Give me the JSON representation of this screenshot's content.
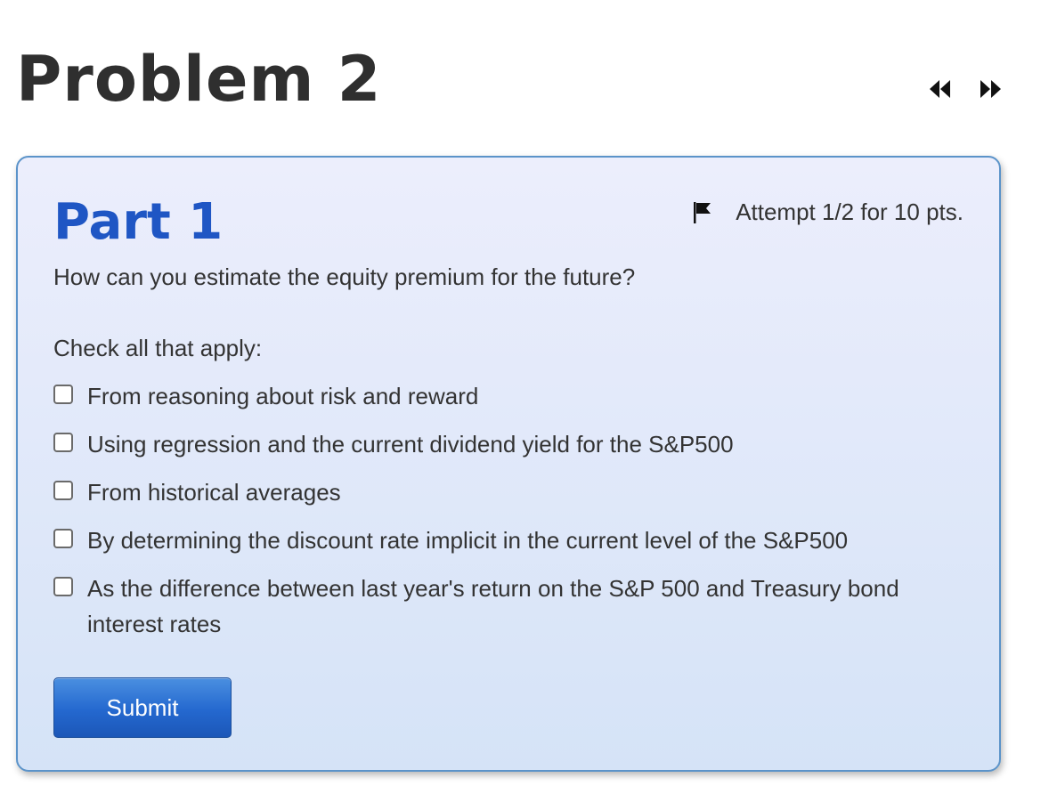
{
  "problem": {
    "title": "Problem 2"
  },
  "nav": {
    "prev_icon": "double-left-arrow",
    "next_icon": "double-right-arrow"
  },
  "part": {
    "title": "Part 1",
    "attempt_text": "Attempt 1/2 for 10 pts.",
    "flag_icon": "flag",
    "question": "How can you estimate the equity premium for the future?",
    "instruction": "Check all that apply:",
    "options": [
      {
        "label": "From reasoning about risk and reward",
        "checked": false
      },
      {
        "label": "Using regression and the current dividend yield for the S&P500",
        "checked": false
      },
      {
        "label": "From historical averages",
        "checked": false
      },
      {
        "label": "By determining the discount rate implicit in the current level of the S&P500",
        "checked": false
      },
      {
        "label": "As the difference between last year's return on the S&P 500 and Treasury bond interest rates",
        "checked": false
      }
    ],
    "submit_label": "Submit"
  },
  "colors": {
    "part_title": "#1f56c4",
    "card_border": "#5b93c9",
    "submit_bg": "#2468cf"
  }
}
